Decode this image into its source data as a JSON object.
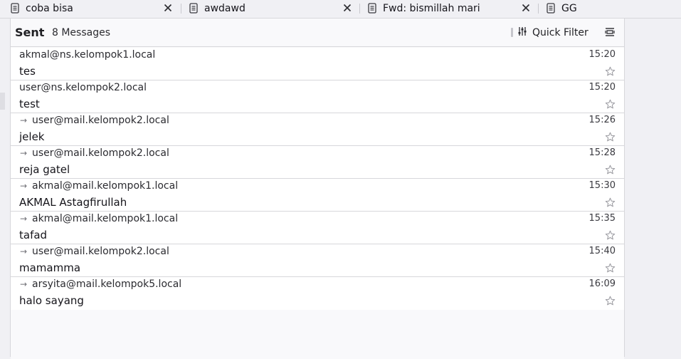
{
  "tabs": [
    {
      "title": "coba bisa",
      "icon": "document-icon"
    },
    {
      "title": "awdawd",
      "icon": "document-icon"
    },
    {
      "title": "Fwd: bismillah mari",
      "icon": "document-icon"
    },
    {
      "title": "GG",
      "icon": "document-icon"
    }
  ],
  "header": {
    "folder": "Sent",
    "count": "8 Messages",
    "quick_filter": "Quick Filter"
  },
  "messages": [
    {
      "from": "akmal@ns.kelompok1.local",
      "time": "15:20",
      "subject": "tes",
      "replied": false
    },
    {
      "from": "user@ns.kelompok2.local",
      "time": "15:20",
      "subject": "test",
      "replied": false
    },
    {
      "from": "user@mail.kelompok2.local",
      "time": "15:26",
      "subject": "jelek",
      "replied": true
    },
    {
      "from": "user@mail.kelompok2.local",
      "time": "15:28",
      "subject": "reja gatel",
      "replied": true
    },
    {
      "from": "akmal@mail.kelompok1.local",
      "time": "15:30",
      "subject": "AKMAL Astagfirullah",
      "replied": true
    },
    {
      "from": "akmal@mail.kelompok1.local",
      "time": "15:35",
      "subject": "tafad",
      "replied": true
    },
    {
      "from": "user@mail.kelompok2.local",
      "time": "15:40",
      "subject": "mamamma",
      "replied": true
    },
    {
      "from": "arsyita@mail.kelompok5.local",
      "time": "16:09",
      "subject": "halo sayang",
      "replied": true
    }
  ],
  "colors": {
    "pane_bg": "#f9f9fb",
    "row_bg": "#ffffff",
    "border": "#d7d7db",
    "text": "#1f1f23",
    "muted": "#707076"
  }
}
